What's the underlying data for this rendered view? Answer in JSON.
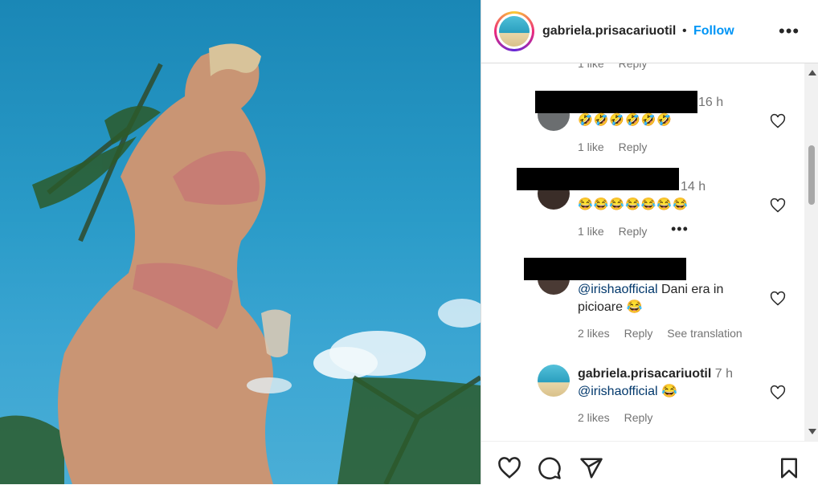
{
  "post": {
    "username": "gabriela.prisacariuotil",
    "separator": "•",
    "follow_label": "Follow",
    "more_label": "•••"
  },
  "comments": [
    {
      "partial_meta": [
        "1 like",
        "Reply"
      ]
    },
    {
      "time": "16 h",
      "text": "🤣🤣🤣🤣🤣🤣",
      "likes": "1 like",
      "reply": "Reply"
    },
    {
      "time": "14 h",
      "text": "😂😂😂😂😂😂😂",
      "likes": "1 like",
      "reply": "Reply",
      "more": "•••"
    },
    {
      "mention": "@irishaofficial",
      "text_line1": " Dani era in",
      "text_line2": "picioare 😂",
      "likes": "2 likes",
      "reply": "Reply",
      "translate": "See translation"
    },
    {
      "username": "gabriela.prisacariuotil",
      "time": "7 h",
      "mention": "@irishaofficial",
      "text": " 😂",
      "likes": "2 likes",
      "reply": "Reply"
    }
  ]
}
